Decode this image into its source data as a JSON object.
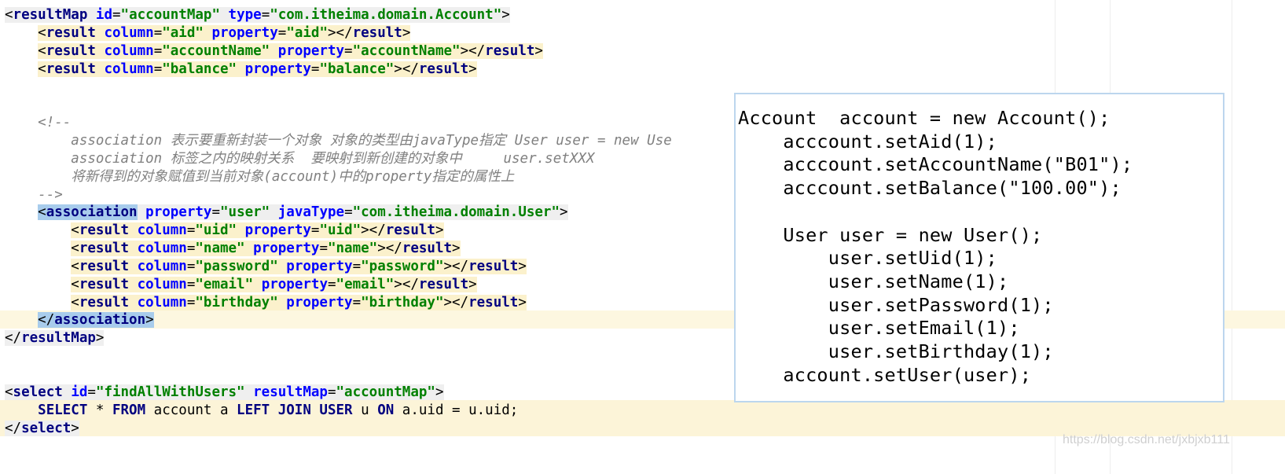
{
  "code_lines": [
    {
      "tokens": [
        {
          "t": "<",
          "c": "c-punct",
          "bg": "bg-tag"
        },
        {
          "t": "resultMap",
          "c": "c-tag",
          "bg": "bg-tag"
        },
        {
          "t": " ",
          "c": "c-plain",
          "bg": "bg-tag"
        },
        {
          "t": "id",
          "c": "c-attr",
          "bg": "bg-tag"
        },
        {
          "t": "=",
          "c": "c-punct",
          "bg": "bg-tag"
        },
        {
          "t": "\"accountMap\"",
          "c": "c-val",
          "bg": "bg-tag"
        },
        {
          "t": " ",
          "c": "c-plain",
          "bg": "bg-tag"
        },
        {
          "t": "type",
          "c": "c-attr",
          "bg": "bg-tag"
        },
        {
          "t": "=",
          "c": "c-punct",
          "bg": "bg-tag"
        },
        {
          "t": "\"com.itheima.domain.Account\"",
          "c": "c-val",
          "bg": "bg-tag"
        },
        {
          "t": ">",
          "c": "c-punct",
          "bg": "bg-tag"
        }
      ]
    },
    {
      "indent": "    ",
      "tokens": [
        {
          "t": "<",
          "c": "c-punct",
          "bg": "bg-yellow"
        },
        {
          "t": "result",
          "c": "c-tag",
          "bg": "bg-yellow"
        },
        {
          "t": " ",
          "c": "c-plain",
          "bg": "bg-yellow"
        },
        {
          "t": "column",
          "c": "c-attr",
          "bg": "bg-yellow"
        },
        {
          "t": "=",
          "c": "c-punct",
          "bg": "bg-yellow"
        },
        {
          "t": "\"aid\"",
          "c": "c-val",
          "bg": "bg-yellow"
        },
        {
          "t": " ",
          "c": "c-plain",
          "bg": "bg-yellow"
        },
        {
          "t": "property",
          "c": "c-attr",
          "bg": "bg-yellow"
        },
        {
          "t": "=",
          "c": "c-punct",
          "bg": "bg-yellow"
        },
        {
          "t": "\"aid\"",
          "c": "c-val",
          "bg": "bg-yellow"
        },
        {
          "t": "></",
          "c": "c-punct",
          "bg": "bg-yellow"
        },
        {
          "t": "result",
          "c": "c-tag",
          "bg": "bg-yellow"
        },
        {
          "t": ">",
          "c": "c-punct",
          "bg": "bg-yellow"
        }
      ]
    },
    {
      "indent": "    ",
      "tokens": [
        {
          "t": "<",
          "c": "c-punct",
          "bg": "bg-yellow"
        },
        {
          "t": "result",
          "c": "c-tag",
          "bg": "bg-yellow"
        },
        {
          "t": " ",
          "c": "c-plain",
          "bg": "bg-yellow"
        },
        {
          "t": "column",
          "c": "c-attr",
          "bg": "bg-yellow"
        },
        {
          "t": "=",
          "c": "c-punct",
          "bg": "bg-yellow"
        },
        {
          "t": "\"accountName\"",
          "c": "c-val",
          "bg": "bg-yellow"
        },
        {
          "t": " ",
          "c": "c-plain",
          "bg": "bg-yellow"
        },
        {
          "t": "property",
          "c": "c-attr",
          "bg": "bg-yellow"
        },
        {
          "t": "=",
          "c": "c-punct",
          "bg": "bg-yellow"
        },
        {
          "t": "\"accountName\"",
          "c": "c-val",
          "bg": "bg-yellow"
        },
        {
          "t": "></",
          "c": "c-punct",
          "bg": "bg-yellow"
        },
        {
          "t": "result",
          "c": "c-tag",
          "bg": "bg-yellow"
        },
        {
          "t": ">",
          "c": "c-punct",
          "bg": "bg-yellow"
        }
      ]
    },
    {
      "indent": "    ",
      "tokens": [
        {
          "t": "<",
          "c": "c-punct",
          "bg": "bg-yellow"
        },
        {
          "t": "result",
          "c": "c-tag",
          "bg": "bg-yellow"
        },
        {
          "t": " ",
          "c": "c-plain",
          "bg": "bg-yellow"
        },
        {
          "t": "column",
          "c": "c-attr",
          "bg": "bg-yellow"
        },
        {
          "t": "=",
          "c": "c-punct",
          "bg": "bg-yellow"
        },
        {
          "t": "\"balance\"",
          "c": "c-val",
          "bg": "bg-yellow"
        },
        {
          "t": " ",
          "c": "c-plain",
          "bg": "bg-yellow"
        },
        {
          "t": "property",
          "c": "c-attr",
          "bg": "bg-yellow"
        },
        {
          "t": "=",
          "c": "c-punct",
          "bg": "bg-yellow"
        },
        {
          "t": "\"balance\"",
          "c": "c-val",
          "bg": "bg-yellow"
        },
        {
          "t": "></",
          "c": "c-punct",
          "bg": "bg-yellow"
        },
        {
          "t": "result",
          "c": "c-tag",
          "bg": "bg-yellow"
        },
        {
          "t": ">",
          "c": "c-punct",
          "bg": "bg-yellow"
        }
      ]
    },
    {
      "tokens": []
    },
    {
      "tokens": []
    },
    {
      "indent": "    ",
      "tokens": [
        {
          "t": "<!--",
          "c": "c-comment"
        }
      ]
    },
    {
      "indent": "        ",
      "tokens": [
        {
          "t": "association 表示要重新封装一个对象 对象的类型由javaType指定 User user = new Use",
          "c": "c-comment"
        }
      ]
    },
    {
      "indent": "        ",
      "tokens": [
        {
          "t": "association 标签之内的映射关系  要映射到新创建的对象中     user.setXXX",
          "c": "c-comment"
        }
      ]
    },
    {
      "indent": "        ",
      "tokens": [
        {
          "t": "将新得到的对象赋值到当前对象(account)中的property指定的属性上",
          "c": "c-comment"
        }
      ]
    },
    {
      "indent": "    ",
      "tokens": [
        {
          "t": "-->",
          "c": "c-comment"
        }
      ]
    },
    {
      "indent": "    ",
      "tokens": [
        {
          "t": "<",
          "c": "c-punct",
          "bg": "bg-sel"
        },
        {
          "t": "association",
          "c": "c-tag",
          "bg": "bg-sel"
        },
        {
          "t": " ",
          "c": "c-plain",
          "bg": "bg-tag"
        },
        {
          "t": "property",
          "c": "c-attr",
          "bg": "bg-tag"
        },
        {
          "t": "=",
          "c": "c-punct",
          "bg": "bg-tag"
        },
        {
          "t": "\"user\"",
          "c": "c-val",
          "bg": "bg-tag"
        },
        {
          "t": " ",
          "c": "c-plain",
          "bg": "bg-tag"
        },
        {
          "t": "javaType",
          "c": "c-attr",
          "bg": "bg-tag"
        },
        {
          "t": "=",
          "c": "c-punct",
          "bg": "bg-tag"
        },
        {
          "t": "\"com.itheima.domain.User\"",
          "c": "c-val",
          "bg": "bg-tag"
        },
        {
          "t": ">",
          "c": "c-punct",
          "bg": "bg-tag"
        }
      ]
    },
    {
      "indent": "        ",
      "tokens": [
        {
          "t": "<",
          "c": "c-punct",
          "bg": "bg-yellow"
        },
        {
          "t": "result",
          "c": "c-tag",
          "bg": "bg-yellow"
        },
        {
          "t": " ",
          "c": "c-plain",
          "bg": "bg-yellow"
        },
        {
          "t": "column",
          "c": "c-attr",
          "bg": "bg-yellow"
        },
        {
          "t": "=",
          "c": "c-punct",
          "bg": "bg-yellow"
        },
        {
          "t": "\"uid\"",
          "c": "c-val",
          "bg": "bg-yellow"
        },
        {
          "t": " ",
          "c": "c-plain",
          "bg": "bg-yellow"
        },
        {
          "t": "property",
          "c": "c-attr",
          "bg": "bg-yellow"
        },
        {
          "t": "=",
          "c": "c-punct",
          "bg": "bg-yellow"
        },
        {
          "t": "\"uid\"",
          "c": "c-val",
          "bg": "bg-yellow"
        },
        {
          "t": "></",
          "c": "c-punct",
          "bg": "bg-yellow"
        },
        {
          "t": "result",
          "c": "c-tag",
          "bg": "bg-yellow"
        },
        {
          "t": ">",
          "c": "c-punct",
          "bg": "bg-yellow"
        }
      ]
    },
    {
      "indent": "        ",
      "tokens": [
        {
          "t": "<",
          "c": "c-punct",
          "bg": "bg-yellow"
        },
        {
          "t": "result",
          "c": "c-tag",
          "bg": "bg-yellow"
        },
        {
          "t": " ",
          "c": "c-plain",
          "bg": "bg-yellow"
        },
        {
          "t": "column",
          "c": "c-attr",
          "bg": "bg-yellow"
        },
        {
          "t": "=",
          "c": "c-punct",
          "bg": "bg-yellow"
        },
        {
          "t": "\"name\"",
          "c": "c-val",
          "bg": "bg-yellow"
        },
        {
          "t": " ",
          "c": "c-plain",
          "bg": "bg-yellow"
        },
        {
          "t": "property",
          "c": "c-attr",
          "bg": "bg-yellow"
        },
        {
          "t": "=",
          "c": "c-punct",
          "bg": "bg-yellow"
        },
        {
          "t": "\"name\"",
          "c": "c-val",
          "bg": "bg-yellow"
        },
        {
          "t": "></",
          "c": "c-punct",
          "bg": "bg-yellow"
        },
        {
          "t": "result",
          "c": "c-tag",
          "bg": "bg-yellow"
        },
        {
          "t": ">",
          "c": "c-punct",
          "bg": "bg-yellow"
        }
      ]
    },
    {
      "indent": "        ",
      "tokens": [
        {
          "t": "<",
          "c": "c-punct",
          "bg": "bg-yellow"
        },
        {
          "t": "result",
          "c": "c-tag",
          "bg": "bg-yellow"
        },
        {
          "t": " ",
          "c": "c-plain",
          "bg": "bg-yellow"
        },
        {
          "t": "column",
          "c": "c-attr",
          "bg": "bg-yellow"
        },
        {
          "t": "=",
          "c": "c-punct",
          "bg": "bg-yellow"
        },
        {
          "t": "\"password\"",
          "c": "c-val",
          "bg": "bg-yellow"
        },
        {
          "t": " ",
          "c": "c-plain",
          "bg": "bg-yellow"
        },
        {
          "t": "property",
          "c": "c-attr",
          "bg": "bg-yellow"
        },
        {
          "t": "=",
          "c": "c-punct",
          "bg": "bg-yellow"
        },
        {
          "t": "\"password\"",
          "c": "c-val",
          "bg": "bg-yellow"
        },
        {
          "t": "></",
          "c": "c-punct",
          "bg": "bg-yellow"
        },
        {
          "t": "result",
          "c": "c-tag",
          "bg": "bg-yellow"
        },
        {
          "t": ">",
          "c": "c-punct",
          "bg": "bg-yellow"
        }
      ]
    },
    {
      "indent": "        ",
      "tokens": [
        {
          "t": "<",
          "c": "c-punct",
          "bg": "bg-yellow"
        },
        {
          "t": "result",
          "c": "c-tag",
          "bg": "bg-yellow"
        },
        {
          "t": " ",
          "c": "c-plain",
          "bg": "bg-yellow"
        },
        {
          "t": "column",
          "c": "c-attr",
          "bg": "bg-yellow"
        },
        {
          "t": "=",
          "c": "c-punct",
          "bg": "bg-yellow"
        },
        {
          "t": "\"email\"",
          "c": "c-val",
          "bg": "bg-yellow"
        },
        {
          "t": " ",
          "c": "c-plain",
          "bg": "bg-yellow"
        },
        {
          "t": "property",
          "c": "c-attr",
          "bg": "bg-yellow"
        },
        {
          "t": "=",
          "c": "c-punct",
          "bg": "bg-yellow"
        },
        {
          "t": "\"email\"",
          "c": "c-val",
          "bg": "bg-yellow"
        },
        {
          "t": "></",
          "c": "c-punct",
          "bg": "bg-yellow"
        },
        {
          "t": "result",
          "c": "c-tag",
          "bg": "bg-yellow"
        },
        {
          "t": ">",
          "c": "c-punct",
          "bg": "bg-yellow"
        }
      ]
    },
    {
      "indent": "        ",
      "tokens": [
        {
          "t": "<",
          "c": "c-punct",
          "bg": "bg-yellow"
        },
        {
          "t": "result",
          "c": "c-tag",
          "bg": "bg-yellow"
        },
        {
          "t": " ",
          "c": "c-plain",
          "bg": "bg-yellow"
        },
        {
          "t": "column",
          "c": "c-attr",
          "bg": "bg-yellow"
        },
        {
          "t": "=",
          "c": "c-punct",
          "bg": "bg-yellow"
        },
        {
          "t": "\"birthday\"",
          "c": "c-val",
          "bg": "bg-yellow"
        },
        {
          "t": " ",
          "c": "c-plain",
          "bg": "bg-yellow"
        },
        {
          "t": "property",
          "c": "c-attr",
          "bg": "bg-yellow"
        },
        {
          "t": "=",
          "c": "c-punct",
          "bg": "bg-yellow"
        },
        {
          "t": "\"birthday\"",
          "c": "c-val",
          "bg": "bg-yellow"
        },
        {
          "t": "></",
          "c": "c-punct",
          "bg": "bg-yellow"
        },
        {
          "t": "result",
          "c": "c-tag",
          "bg": "bg-yellow"
        },
        {
          "t": ">",
          "c": "c-punct",
          "bg": "bg-yellow"
        }
      ]
    },
    {
      "indent": "    ",
      "tokens": [
        {
          "t": "</",
          "c": "c-punct",
          "bg": "bg-sel"
        },
        {
          "t": "association",
          "c": "c-tag",
          "bg": "bg-sel"
        },
        {
          "t": ">",
          "c": "c-punct",
          "bg": "bg-sel"
        }
      ]
    },
    {
      "tokens": [
        {
          "t": "</",
          "c": "c-punct",
          "bg": "bg-tag"
        },
        {
          "t": "resultMap",
          "c": "c-tag",
          "bg": "bg-tag"
        },
        {
          "t": ">",
          "c": "c-punct",
          "bg": "bg-tag"
        }
      ]
    },
    {
      "tokens": []
    },
    {
      "tokens": []
    },
    {
      "tokens": [
        {
          "t": "<",
          "c": "c-punct",
          "bg": "bg-tag"
        },
        {
          "t": "select",
          "c": "c-tag",
          "bg": "bg-tag"
        },
        {
          "t": " ",
          "c": "c-plain",
          "bg": "bg-tag"
        },
        {
          "t": "id",
          "c": "c-attr",
          "bg": "bg-tag"
        },
        {
          "t": "=",
          "c": "c-punct",
          "bg": "bg-tag"
        },
        {
          "t": "\"findAllWithUsers\"",
          "c": "c-val",
          "bg": "bg-tag"
        },
        {
          "t": " ",
          "c": "c-plain",
          "bg": "bg-tag"
        },
        {
          "t": "resultMap",
          "c": "c-attr",
          "bg": "bg-tag"
        },
        {
          "t": "=",
          "c": "c-punct",
          "bg": "bg-tag"
        },
        {
          "t": "\"accountMap\"",
          "c": "c-val",
          "bg": "bg-tag"
        },
        {
          "t": ">",
          "c": "c-punct",
          "bg": "bg-tag"
        }
      ]
    },
    {
      "indent": "    ",
      "tokens": [
        {
          "t": "SELECT",
          "c": "c-kw"
        },
        {
          "t": " * ",
          "c": "c-plain"
        },
        {
          "t": "FROM",
          "c": "c-kw"
        },
        {
          "t": " account a ",
          "c": "c-plain"
        },
        {
          "t": "LEFT JOIN",
          "c": "c-kw"
        },
        {
          "t": " ",
          "c": "c-plain"
        },
        {
          "t": "USER",
          "c": "c-kw"
        },
        {
          "t": " u ",
          "c": "c-plain"
        },
        {
          "t": "ON",
          "c": "c-kw"
        },
        {
          "t": " a.uid = u.uid;",
          "c": "c-plain"
        }
      ]
    },
    {
      "tokens": [
        {
          "t": "</",
          "c": "c-punct",
          "bg": "bg-tag"
        },
        {
          "t": "select",
          "c": "c-tag",
          "bg": "bg-tag"
        },
        {
          "t": ">",
          "c": "c-punct",
          "bg": "bg-tag"
        }
      ]
    }
  ],
  "overlay_lines": [
    "Account  account = new Account();",
    "    acccount.setAid(1);",
    "    acccount.setAccountName(\"B01\");",
    "    acccount.setBalance(\"100.00\");",
    "",
    "    User user = new User();",
    "        user.setUid(1);",
    "        user.setName(1);",
    "        user.setPassword(1);",
    "        user.setEmail(1);",
    "        user.setBirthday(1);",
    "    account.setUser(user);"
  ],
  "watermark": "https://blog.csdn.net/jxbjxb111",
  "colors": {
    "tag": "#000080",
    "attribute": "#0000ff",
    "value": "#008000",
    "comment": "#808080",
    "selection": "#a8ccec",
    "line_highlight": "#fbf1cc",
    "overlay_border": "#bcd6ee"
  }
}
